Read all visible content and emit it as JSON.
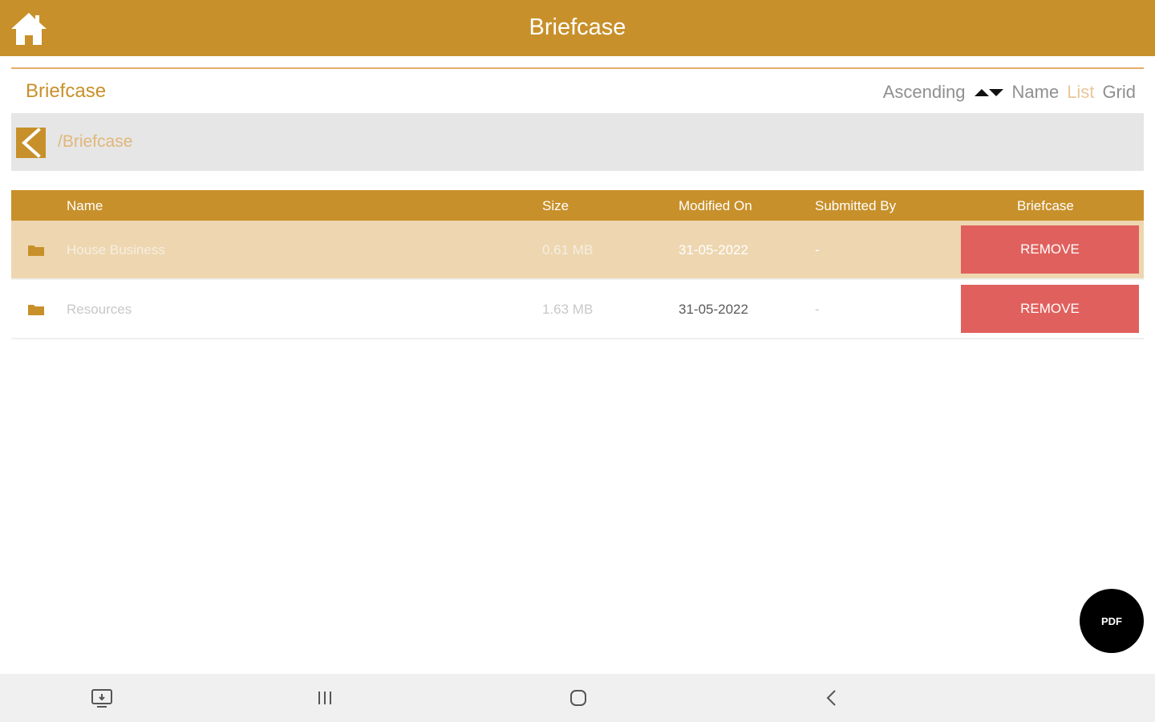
{
  "app": {
    "title": "Briefcase"
  },
  "section": {
    "title": "Briefcase"
  },
  "sort": {
    "order_label": "Ascending",
    "field_label": "Name",
    "view_list_label": "List",
    "view_grid_label": "Grid"
  },
  "path": {
    "current": "/Briefcase"
  },
  "table": {
    "headers": {
      "name": "Name",
      "size": "Size",
      "modified": "Modified On",
      "submitted_by": "Submitted By",
      "briefcase": "Briefcase"
    },
    "rows": [
      {
        "name": "House Business",
        "size": "0.61 MB",
        "modified": "31-05-2022",
        "submitted_by": "-",
        "action": "REMOVE",
        "selected": true
      },
      {
        "name": "Resources",
        "size": "1.63 MB",
        "modified": "31-05-2022",
        "submitted_by": "-",
        "action": "REMOVE",
        "selected": false
      }
    ]
  },
  "fab": {
    "label": "PDF"
  },
  "icons": {
    "home": "home-icon",
    "back": "back-arrow-icon",
    "folder": "folder-icon",
    "sort": "sort-arrows-icon"
  },
  "colors": {
    "primary": "#c8902a",
    "selected_row": "#edd6b0",
    "remove": "#e0605d",
    "fab": "#000000"
  }
}
